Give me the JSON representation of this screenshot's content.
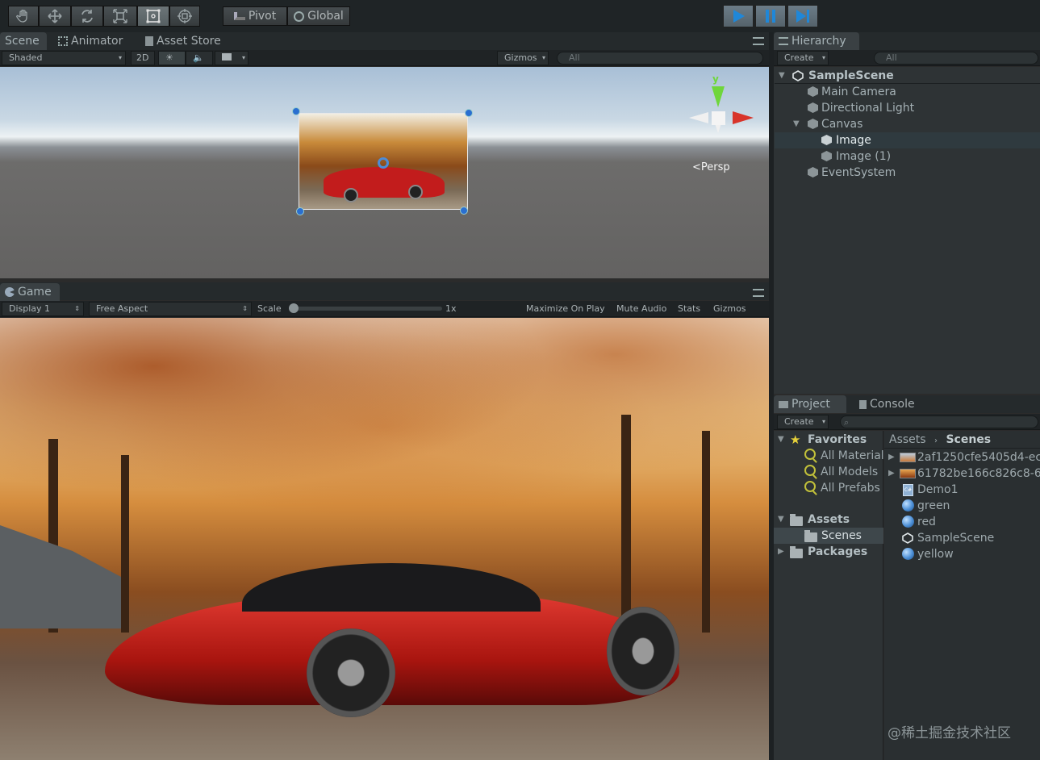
{
  "toolbar": {
    "tools": [
      {
        "icon": "hand-tool-icon"
      },
      {
        "icon": "move-tool-icon"
      },
      {
        "icon": "rotate-tool-icon"
      },
      {
        "icon": "scale-tool-icon"
      },
      {
        "icon": "rect-tool-icon",
        "selected": true
      },
      {
        "icon": "transform-tool-icon"
      }
    ],
    "pivot_label": "Pivot",
    "global_label": "Global",
    "play_icons": [
      "play-icon",
      "pause-icon",
      "step-icon"
    ]
  },
  "scene_panel": {
    "tabs": [
      "Scene",
      "Animator",
      "Asset Store"
    ],
    "shading_mode": "Shaded",
    "toggle_2d": "2D",
    "gizmos_label": "Gizmos",
    "search_placeholder": "All",
    "persp_label": "Persp",
    "gizmo_axis_y": "y"
  },
  "game_panel": {
    "tab": "Game",
    "display": "Display 1",
    "aspect": "Free Aspect",
    "scale_label": "Scale",
    "scale_value": "1x",
    "scale_level": 0,
    "maximize_on_play": "Maximize On Play",
    "mute_audio": "Mute Audio",
    "stats": "Stats",
    "gizmos": "Gizmos"
  },
  "hierarchy": {
    "tab": "Hierarchy",
    "create_label": "Create",
    "search_placeholder": "All",
    "items": [
      {
        "label": "SampleScene",
        "depth": 0,
        "expanded": true,
        "scene": true
      },
      {
        "label": "Main Camera",
        "depth": 1
      },
      {
        "label": "Directional Light",
        "depth": 1
      },
      {
        "label": "Canvas",
        "depth": 1,
        "expanded": true
      },
      {
        "label": "Image",
        "depth": 2,
        "selected": true
      },
      {
        "label": "Image (1)",
        "depth": 2
      },
      {
        "label": "EventSystem",
        "depth": 1
      }
    ]
  },
  "project": {
    "tabs": [
      "Project",
      "Console"
    ],
    "create_label": "Create",
    "favorites_label": "Favorites",
    "favorites": [
      "All Materials",
      "All Models",
      "All Prefabs"
    ],
    "assets_label": "Assets",
    "assets_children": [
      "Scenes"
    ],
    "packages_label": "Packages",
    "breadcrumb": [
      "Assets",
      "Scenes"
    ],
    "files": [
      {
        "name": "2af1250cfe5405d4-ec",
        "icon": "texture-icon"
      },
      {
        "name": "61782be166c826c8-6",
        "icon": "texture-icon"
      },
      {
        "name": "Demo1",
        "icon": "script-icon"
      },
      {
        "name": "green",
        "icon": "material-icon"
      },
      {
        "name": "red",
        "icon": "material-icon"
      },
      {
        "name": "SampleScene",
        "icon": "unity-scene-icon"
      },
      {
        "name": "yellow",
        "icon": "material-icon"
      }
    ]
  },
  "watermark": "@稀土掘金技术社区"
}
